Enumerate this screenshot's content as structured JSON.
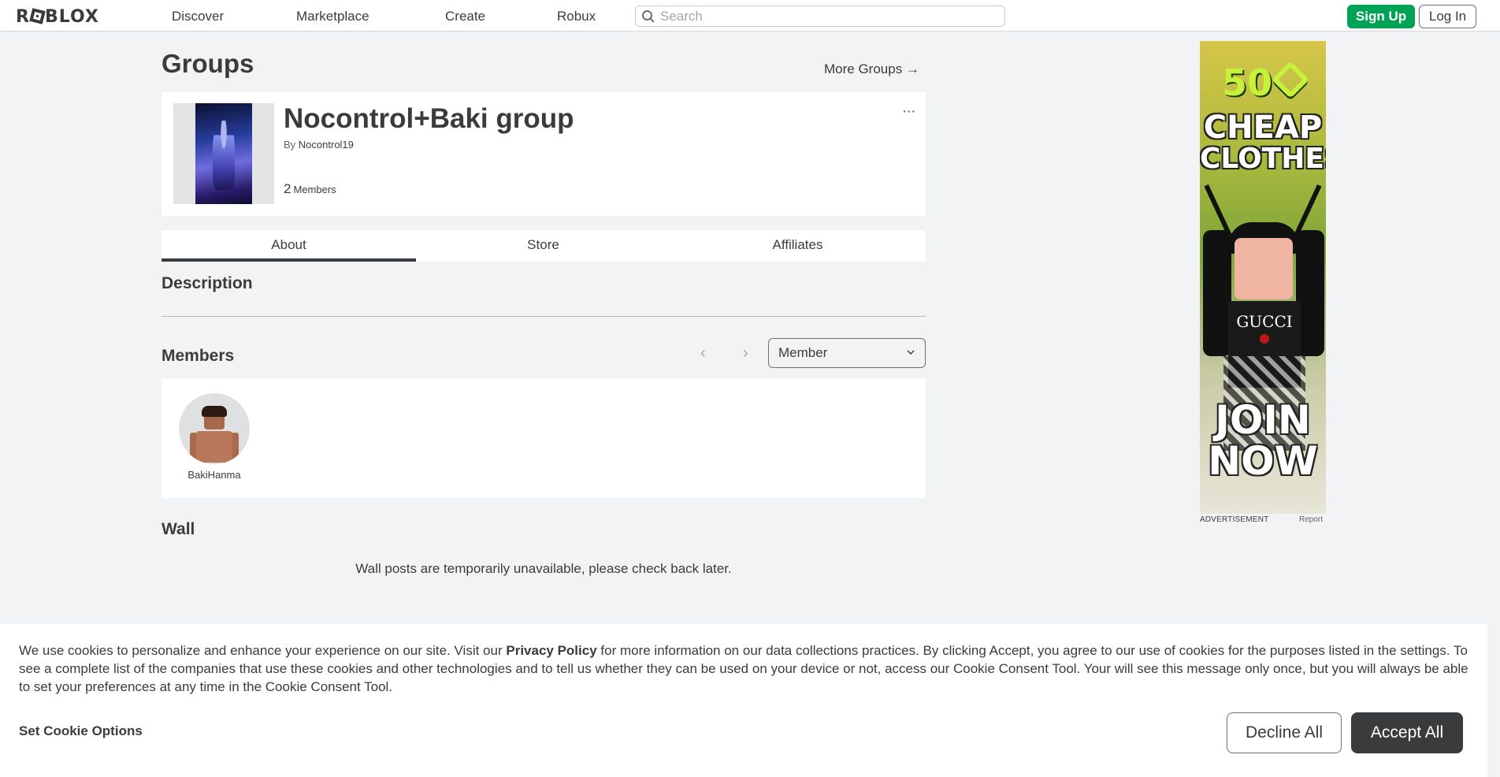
{
  "nav": {
    "logo": "ROBLOX",
    "links": [
      "Discover",
      "Marketplace",
      "Create",
      "Robux"
    ],
    "search_placeholder": "Search",
    "signup": "Sign Up",
    "login": "Log In"
  },
  "page": {
    "title": "Groups",
    "more_groups": "More Groups →"
  },
  "group": {
    "name": "Nocontrol+Baki group",
    "by_label": "By",
    "owner": "Nocontrol19",
    "member_count": "2",
    "members_label": "Members",
    "menu": "···"
  },
  "tabs": [
    "About",
    "Store",
    "Affiliates"
  ],
  "sections": {
    "description": "Description",
    "members": "Members",
    "wall": "Wall"
  },
  "members_list": {
    "prev": "‹",
    "next": "›",
    "role_filter": "Member",
    "members": [
      {
        "name": "BakiHanma"
      }
    ]
  },
  "wall": {
    "message": "Wall posts are temporarily unavailable, please check back later."
  },
  "ad": {
    "top_text": "50",
    "line1": "CHEAP",
    "line2": "CLOTHES",
    "shirt_text": "GUCCI",
    "line3": "JOIN",
    "line4": "NOW",
    "label": "ADVERTISEMENT",
    "report": "Report"
  },
  "cookie": {
    "text_before": "We use cookies to personalize and enhance your experience on our site. Visit our ",
    "policy_link": "Privacy Policy",
    "text_after": " for more information on our data collections practices. By clicking Accept, you agree to our use of cookies for the purposes listed in the settings. To see a complete list of the companies that use these cookies and other technologies and to tell us whether they can be used on your device or not, access our Cookie Consent Tool. Your will see this message only once, but you will always be able to set your preferences at any time in the Cookie Consent Tool.",
    "set_options": "Set Cookie Options",
    "decline": "Decline All",
    "accept": "Accept All"
  },
  "colors": {
    "accent_green": "#00a256",
    "text": "#393b3d",
    "background": "#f2f3f5"
  }
}
